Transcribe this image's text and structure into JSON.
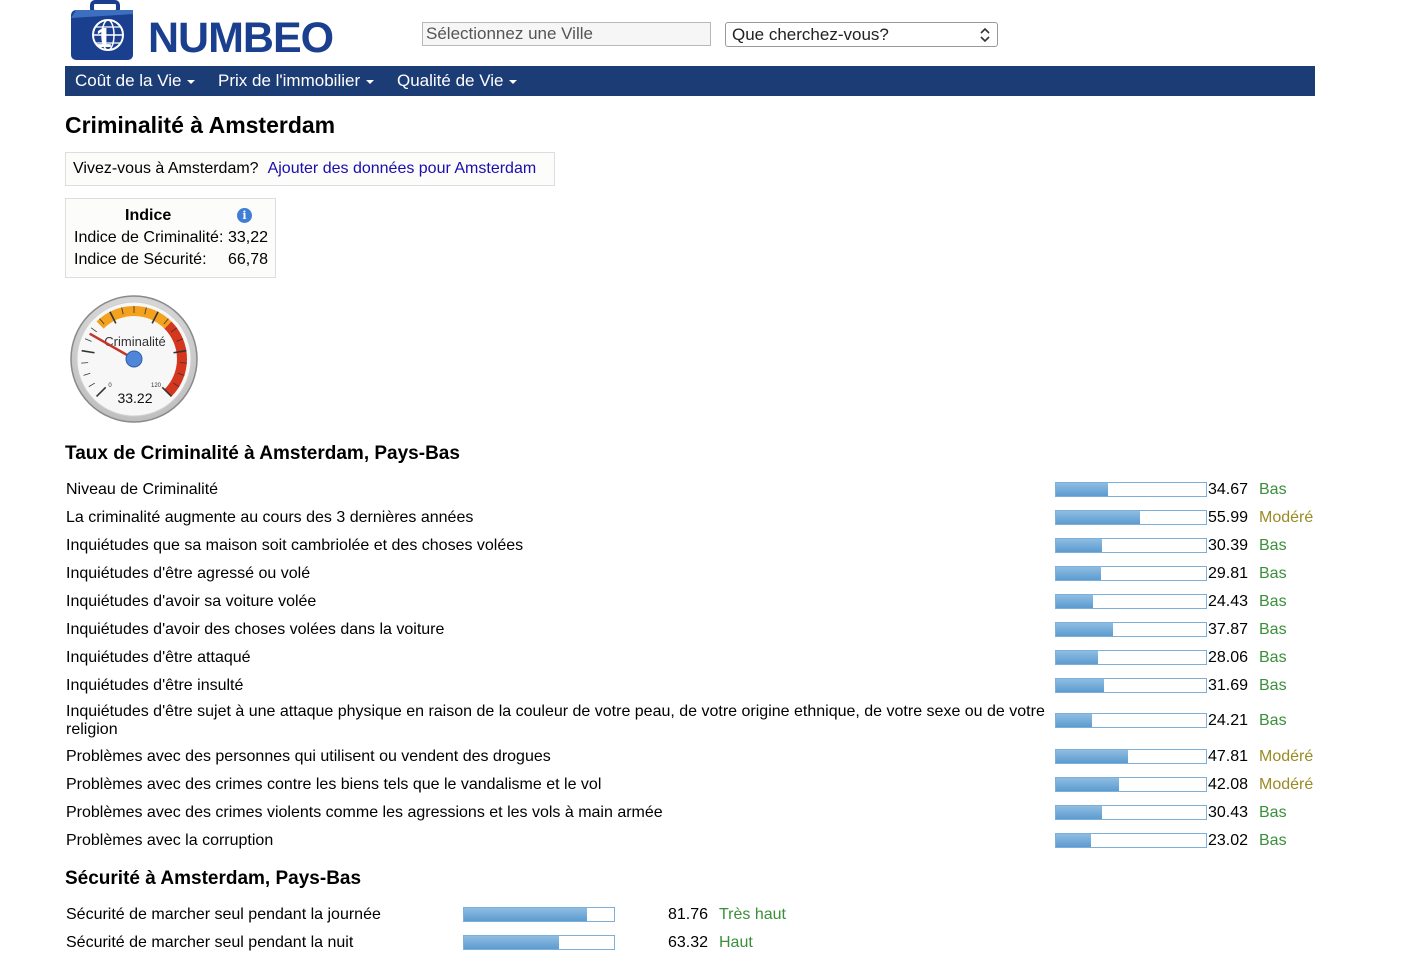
{
  "header": {
    "logo_text": "NUMBEO",
    "city_search_placeholder": "Sélectionnez une Ville",
    "search_select_value": "Que cherchez-vous?"
  },
  "nav": {
    "items": [
      {
        "label": "Coût de la Vie"
      },
      {
        "label": "Prix de l'immobilier"
      },
      {
        "label": "Qualité de Vie"
      }
    ]
  },
  "page_title": "Criminalité à Amsterdam",
  "live_box": {
    "question": "Vivez-vous à Amsterdam?",
    "link": "Ajouter des données pour Amsterdam"
  },
  "index_box": {
    "header": "Indice",
    "crime_label": "Indice de Criminalité:",
    "crime_value": "33,22",
    "safety_label": "Indice de Sécurité:",
    "safety_value": "66,78"
  },
  "gauge": {
    "label": "Criminalité",
    "value": "33.22",
    "min": "0",
    "max": "120",
    "value_number": 33.22
  },
  "crime_section": {
    "title": "Taux de Criminalité à Amsterdam, Pays-Bas",
    "rows": [
      {
        "label": "Niveau de Criminalité",
        "value": "34.67",
        "level": "Bas",
        "pct": 34.67
      },
      {
        "label": "La criminalité augmente au cours des 3 dernières années",
        "value": "55.99",
        "level": "Modéré",
        "pct": 55.99
      },
      {
        "label": "Inquiétudes que sa maison soit cambriolée et des choses volées",
        "value": "30.39",
        "level": "Bas",
        "pct": 30.39
      },
      {
        "label": "Inquiétudes d'être agressé ou volé",
        "value": "29.81",
        "level": "Bas",
        "pct": 29.81
      },
      {
        "label": "Inquiétudes d'avoir sa voiture volée",
        "value": "24.43",
        "level": "Bas",
        "pct": 24.43
      },
      {
        "label": "Inquiétudes d'avoir des choses volées dans la voiture",
        "value": "37.87",
        "level": "Bas",
        "pct": 37.87
      },
      {
        "label": "Inquiétudes d'être attaqué",
        "value": "28.06",
        "level": "Bas",
        "pct": 28.06
      },
      {
        "label": "Inquiétudes d'être insulté",
        "value": "31.69",
        "level": "Bas",
        "pct": 31.69
      },
      {
        "label": "Inquiétudes d'être sujet à une attaque physique en raison de la couleur de votre peau, de votre origine ethnique, de votre sexe ou de votre religion",
        "value": "24.21",
        "level": "Bas",
        "pct": 24.21
      },
      {
        "label": "Problèmes avec des personnes qui utilisent ou vendent des drogues",
        "value": "47.81",
        "level": "Modéré",
        "pct": 47.81
      },
      {
        "label": "Problèmes avec des crimes contre les biens tels que le vandalisme et le vol",
        "value": "42.08",
        "level": "Modéré",
        "pct": 42.08
      },
      {
        "label": "Problèmes avec des crimes violents comme les agressions et les vols à main armée",
        "value": "30.43",
        "level": "Bas",
        "pct": 30.43
      },
      {
        "label": "Problèmes avec la corruption",
        "value": "23.02",
        "level": "Bas",
        "pct": 23.02
      }
    ]
  },
  "safety_section": {
    "title": "Sécurité à Amsterdam, Pays-Bas",
    "rows": [
      {
        "label": "Sécurité de marcher seul pendant la journée",
        "value": "81.76",
        "level": "Très haut",
        "pct": 81.76
      },
      {
        "label": "Sécurité de marcher seul pendant la nuit",
        "value": "63.32",
        "level": "Haut",
        "pct": 63.32
      }
    ]
  },
  "colors": {
    "navbar": "#1c3c76",
    "logo": "#1b3f8f",
    "level_low": "#3a8f3a",
    "level_moderate": "#9a8b22",
    "level_high": "#3a8f3a"
  }
}
